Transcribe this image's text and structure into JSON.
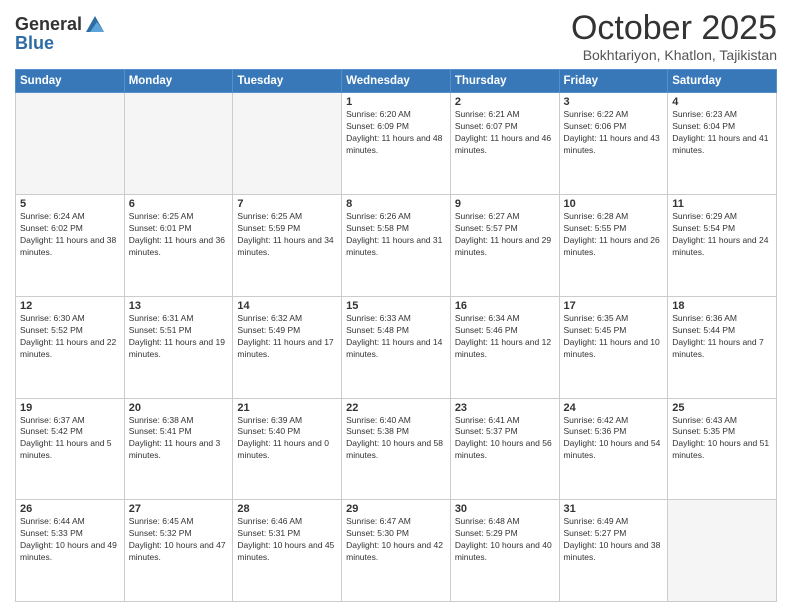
{
  "header": {
    "logo_general": "General",
    "logo_blue": "Blue",
    "month_title": "October 2025",
    "location": "Bokhtariyon, Khatlon, Tajikistan"
  },
  "days_of_week": [
    "Sunday",
    "Monday",
    "Tuesday",
    "Wednesday",
    "Thursday",
    "Friday",
    "Saturday"
  ],
  "weeks": [
    [
      {
        "day": null,
        "info": null
      },
      {
        "day": null,
        "info": null
      },
      {
        "day": null,
        "info": null
      },
      {
        "day": "1",
        "info": "Sunrise: 6:20 AM\nSunset: 6:09 PM\nDaylight: 11 hours and 48 minutes."
      },
      {
        "day": "2",
        "info": "Sunrise: 6:21 AM\nSunset: 6:07 PM\nDaylight: 11 hours and 46 minutes."
      },
      {
        "day": "3",
        "info": "Sunrise: 6:22 AM\nSunset: 6:06 PM\nDaylight: 11 hours and 43 minutes."
      },
      {
        "day": "4",
        "info": "Sunrise: 6:23 AM\nSunset: 6:04 PM\nDaylight: 11 hours and 41 minutes."
      }
    ],
    [
      {
        "day": "5",
        "info": "Sunrise: 6:24 AM\nSunset: 6:02 PM\nDaylight: 11 hours and 38 minutes."
      },
      {
        "day": "6",
        "info": "Sunrise: 6:25 AM\nSunset: 6:01 PM\nDaylight: 11 hours and 36 minutes."
      },
      {
        "day": "7",
        "info": "Sunrise: 6:25 AM\nSunset: 5:59 PM\nDaylight: 11 hours and 34 minutes."
      },
      {
        "day": "8",
        "info": "Sunrise: 6:26 AM\nSunset: 5:58 PM\nDaylight: 11 hours and 31 minutes."
      },
      {
        "day": "9",
        "info": "Sunrise: 6:27 AM\nSunset: 5:57 PM\nDaylight: 11 hours and 29 minutes."
      },
      {
        "day": "10",
        "info": "Sunrise: 6:28 AM\nSunset: 5:55 PM\nDaylight: 11 hours and 26 minutes."
      },
      {
        "day": "11",
        "info": "Sunrise: 6:29 AM\nSunset: 5:54 PM\nDaylight: 11 hours and 24 minutes."
      }
    ],
    [
      {
        "day": "12",
        "info": "Sunrise: 6:30 AM\nSunset: 5:52 PM\nDaylight: 11 hours and 22 minutes."
      },
      {
        "day": "13",
        "info": "Sunrise: 6:31 AM\nSunset: 5:51 PM\nDaylight: 11 hours and 19 minutes."
      },
      {
        "day": "14",
        "info": "Sunrise: 6:32 AM\nSunset: 5:49 PM\nDaylight: 11 hours and 17 minutes."
      },
      {
        "day": "15",
        "info": "Sunrise: 6:33 AM\nSunset: 5:48 PM\nDaylight: 11 hours and 14 minutes."
      },
      {
        "day": "16",
        "info": "Sunrise: 6:34 AM\nSunset: 5:46 PM\nDaylight: 11 hours and 12 minutes."
      },
      {
        "day": "17",
        "info": "Sunrise: 6:35 AM\nSunset: 5:45 PM\nDaylight: 11 hours and 10 minutes."
      },
      {
        "day": "18",
        "info": "Sunrise: 6:36 AM\nSunset: 5:44 PM\nDaylight: 11 hours and 7 minutes."
      }
    ],
    [
      {
        "day": "19",
        "info": "Sunrise: 6:37 AM\nSunset: 5:42 PM\nDaylight: 11 hours and 5 minutes."
      },
      {
        "day": "20",
        "info": "Sunrise: 6:38 AM\nSunset: 5:41 PM\nDaylight: 11 hours and 3 minutes."
      },
      {
        "day": "21",
        "info": "Sunrise: 6:39 AM\nSunset: 5:40 PM\nDaylight: 11 hours and 0 minutes."
      },
      {
        "day": "22",
        "info": "Sunrise: 6:40 AM\nSunset: 5:38 PM\nDaylight: 10 hours and 58 minutes."
      },
      {
        "day": "23",
        "info": "Sunrise: 6:41 AM\nSunset: 5:37 PM\nDaylight: 10 hours and 56 minutes."
      },
      {
        "day": "24",
        "info": "Sunrise: 6:42 AM\nSunset: 5:36 PM\nDaylight: 10 hours and 54 minutes."
      },
      {
        "day": "25",
        "info": "Sunrise: 6:43 AM\nSunset: 5:35 PM\nDaylight: 10 hours and 51 minutes."
      }
    ],
    [
      {
        "day": "26",
        "info": "Sunrise: 6:44 AM\nSunset: 5:33 PM\nDaylight: 10 hours and 49 minutes."
      },
      {
        "day": "27",
        "info": "Sunrise: 6:45 AM\nSunset: 5:32 PM\nDaylight: 10 hours and 47 minutes."
      },
      {
        "day": "28",
        "info": "Sunrise: 6:46 AM\nSunset: 5:31 PM\nDaylight: 10 hours and 45 minutes."
      },
      {
        "day": "29",
        "info": "Sunrise: 6:47 AM\nSunset: 5:30 PM\nDaylight: 10 hours and 42 minutes."
      },
      {
        "day": "30",
        "info": "Sunrise: 6:48 AM\nSunset: 5:29 PM\nDaylight: 10 hours and 40 minutes."
      },
      {
        "day": "31",
        "info": "Sunrise: 6:49 AM\nSunset: 5:27 PM\nDaylight: 10 hours and 38 minutes."
      },
      {
        "day": null,
        "info": null
      }
    ]
  ]
}
